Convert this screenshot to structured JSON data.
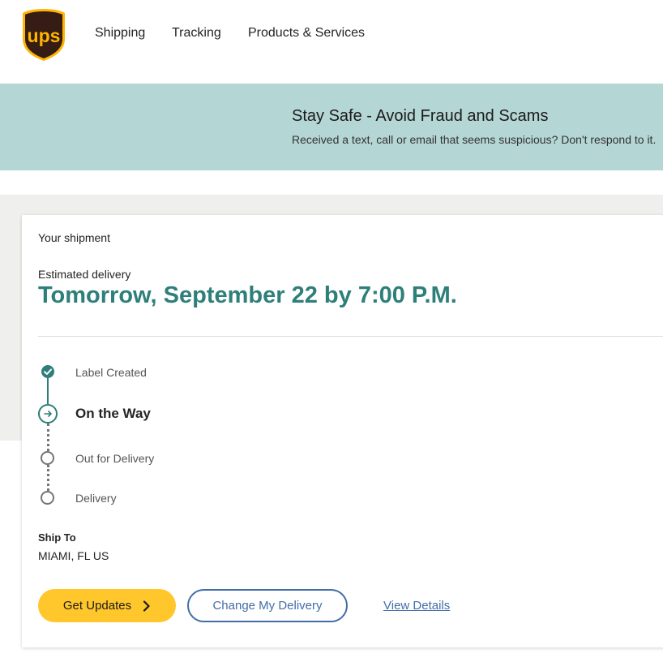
{
  "header": {
    "logo_text": "ups",
    "nav": [
      {
        "label": "Shipping"
      },
      {
        "label": "Tracking"
      },
      {
        "label": "Products & Services"
      }
    ]
  },
  "banner": {
    "title": "Stay Safe - Avoid Fraud and Scams",
    "text": "Received a text, call or email that seems suspicious? Don't respond to it."
  },
  "shipment": {
    "heading": "Your shipment",
    "estimated_label": "Estimated delivery",
    "estimated_date": "Tomorrow, September 22 by 7:00 P.M.",
    "steps": [
      {
        "label": "Label Created",
        "state": "done"
      },
      {
        "label": "On the Way",
        "state": "current"
      },
      {
        "label": "Out for Delivery",
        "state": "pending"
      },
      {
        "label": "Delivery",
        "state": "pending"
      }
    ],
    "ship_to_label": "Ship To",
    "ship_to_value": "MIAMI, FL US"
  },
  "actions": {
    "get_updates": "Get Updates",
    "change_delivery": "Change My Delivery",
    "view_details": "View Details"
  },
  "colors": {
    "brand_brown": "#351c15",
    "brand_gold": "#ffb500",
    "accent_teal": "#2e7f7a",
    "banner_bg": "#b4d6d4",
    "button_yellow": "#ffc72c",
    "link_blue": "#426da9"
  }
}
